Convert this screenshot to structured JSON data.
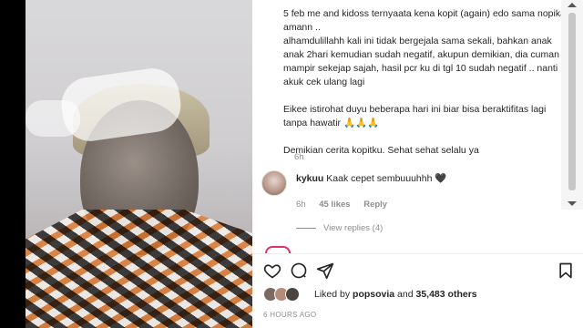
{
  "post": {
    "caption_paragraphs": [
      "5 feb me and kidoss ternyaata kena kopit (again) edo sama nopika amann ..\nalhamdulillahh kali ini tidak bergejala sama sekali, bahkan anak anak 2hari kemudian sudah negatif, akupun demikian, dia cuman mampir sekejap sajah, hasil pcr ku di tgl 10 sudah negatif .. nanti akuk cek ulang lagi",
      "Eikee istirohat duyu beberapa hari ini biar bisa beraktifitas lagi tanpa hawatir 🙏🙏🙏",
      "Demikian cerita kopitku. Sehat sehat selalu ya"
    ],
    "caption_age": "6h"
  },
  "comment": {
    "username": "kykuu",
    "text": "Kaak cepet sembuuuhhh 🖤",
    "age": "6h",
    "likes": "45 likes",
    "reply_label": "Reply",
    "view_replies": "View replies (4)"
  },
  "likes": {
    "prefix": "Liked by",
    "user": "popsovia",
    "connector": "and",
    "count": "35,483 others"
  },
  "timestamp": "6 HOURS AGO",
  "icons": {
    "like": "heart-icon",
    "comment": "comment-icon",
    "share": "send-icon",
    "save": "bookmark-icon"
  },
  "colors": {
    "text": "#262626",
    "secondary": "#8e8e8e",
    "story_ring": "#e1306c"
  }
}
